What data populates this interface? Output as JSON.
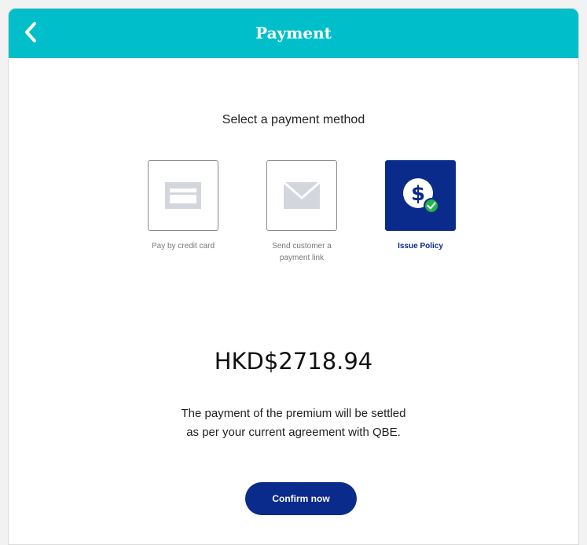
{
  "header": {
    "title": "Payment",
    "back_icon": "chevron-left-icon",
    "background_color": "#00bfcb"
  },
  "main": {
    "subtitle": "Select a payment method",
    "methods": [
      {
        "label": "Pay by credit card",
        "icon": "credit-card-icon",
        "selected": false
      },
      {
        "label": "Send customer a payment link",
        "icon": "envelope-icon",
        "selected": false
      },
      {
        "label": "Issue Policy",
        "icon": "dollar-check-icon",
        "selected": true
      }
    ],
    "amount": "HKD$2718.94",
    "note_line1": "The payment of the premium will be settled",
    "note_line2": "as per your current agreement with QBE.",
    "confirm_label": "Confirm now"
  },
  "colors": {
    "accent": "#00bfcb",
    "primary": "#0a2a8c",
    "success": "#22b24c",
    "icon_grey": "#d3d6dd"
  }
}
